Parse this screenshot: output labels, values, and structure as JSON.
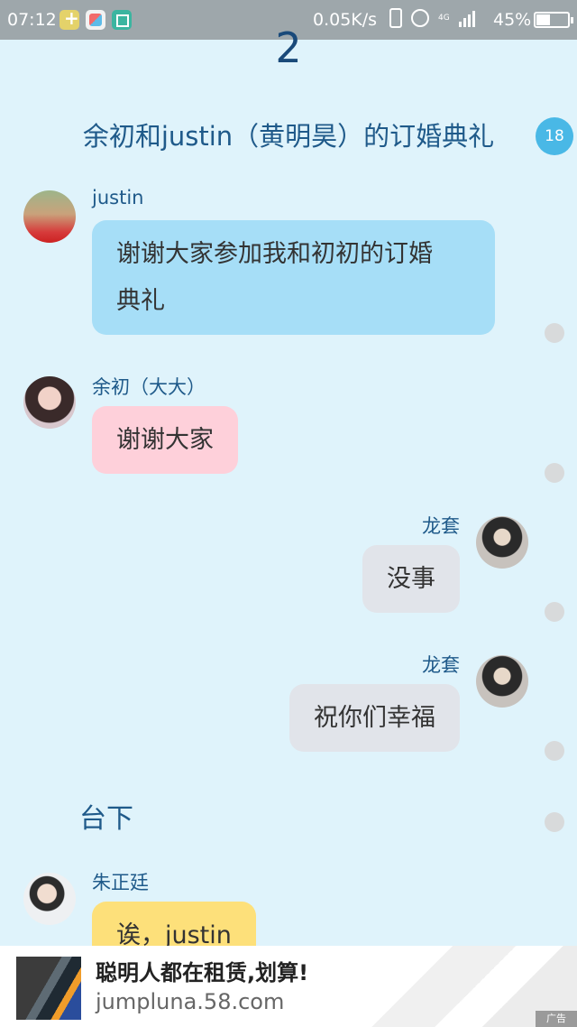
{
  "status_bar": {
    "time": "07:12",
    "speed": "0.05K/s",
    "network": "4G",
    "battery": "45%"
  },
  "header": {
    "page_number": "2",
    "title": "余初和justin（黄明昊）的订婚典礼",
    "badge_count": "18"
  },
  "messages": [
    {
      "name": "justin",
      "text": "谢谢大家参加我和初初的订婚典礼",
      "line1": "谢谢大家参加我和初初的订婚",
      "line2": "典礼",
      "side": "left",
      "color": "#a6def7"
    },
    {
      "name": "余初（大大）",
      "text": "谢谢大家",
      "side": "left",
      "color": "#fed0da"
    },
    {
      "name": "龙套",
      "text": "没事",
      "side": "right",
      "color": "#e1e4ea"
    },
    {
      "name": "龙套",
      "text": "祝你们幸福",
      "side": "right",
      "color": "#e1e4ea"
    }
  ],
  "section_label": "台下",
  "last_message": {
    "name": "朱正廷",
    "text": "诶，justin",
    "color": "#fde07a"
  },
  "ad": {
    "title": "聪明人都在租赁,划算!",
    "url": "jumpluna.58.com",
    "tag": "广告"
  },
  "icons": [
    "vibrate-icon",
    "alarm-icon",
    "signal-icon",
    "battery-icon",
    "avatar",
    "ad-image"
  ]
}
